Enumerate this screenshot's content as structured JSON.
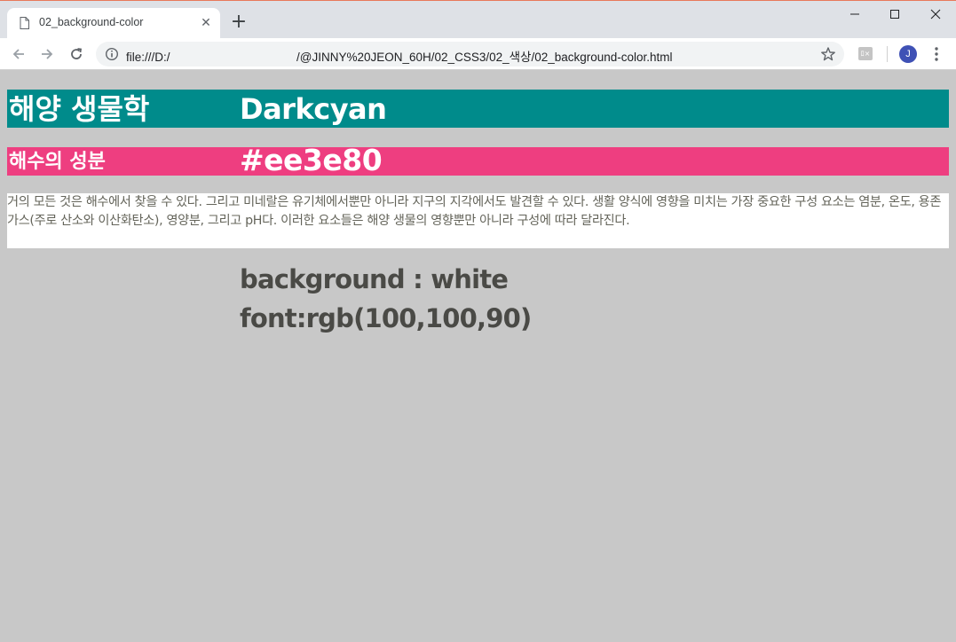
{
  "browser": {
    "tab": {
      "title": "02_background-color",
      "close_glyph": "✕",
      "favicon": "page-icon"
    },
    "new_tab_glyph": "+",
    "window_controls": {
      "minimize": "minimize-icon",
      "maximize": "maximize-icon",
      "close": "close-icon"
    },
    "toolbar": {
      "url": "file:///D:/                                      /@JINNY%20JEON_60H/02_CSS3/02_색상/02_background-color.html",
      "extension_label": "ﾛ×",
      "avatar_initial": "J"
    }
  },
  "page": {
    "h1": {
      "text": "해양 생물학",
      "note": "Darkcyan",
      "background": "#008b8b"
    },
    "h2": {
      "text": "해수의 성분",
      "note": "#ee3e80",
      "background": "#ee3e80"
    },
    "paragraph": {
      "text": "거의 모든 것은 해수에서 찾을 수 있다. 그리고 미네랄은 유기체에서뿐만 아니라 지구의 지각에서도 발견할 수 있다. 생활 양식에 영향을 미치는 가장 중요한 구성 요소는 염분, 온도, 용존 가스(주로 산소와 이산화탄소), 영양분, 그리고 pH다. 이러한 요소들은 해양 생물의 영향뿐만 아니라 구성에 따라 달라진다.",
      "background": "#ffffff",
      "color": "#64645a"
    },
    "note_lines": [
      "background : white",
      "font:rgb(100,100,90)"
    ],
    "body_background": "#c8c8c8"
  }
}
